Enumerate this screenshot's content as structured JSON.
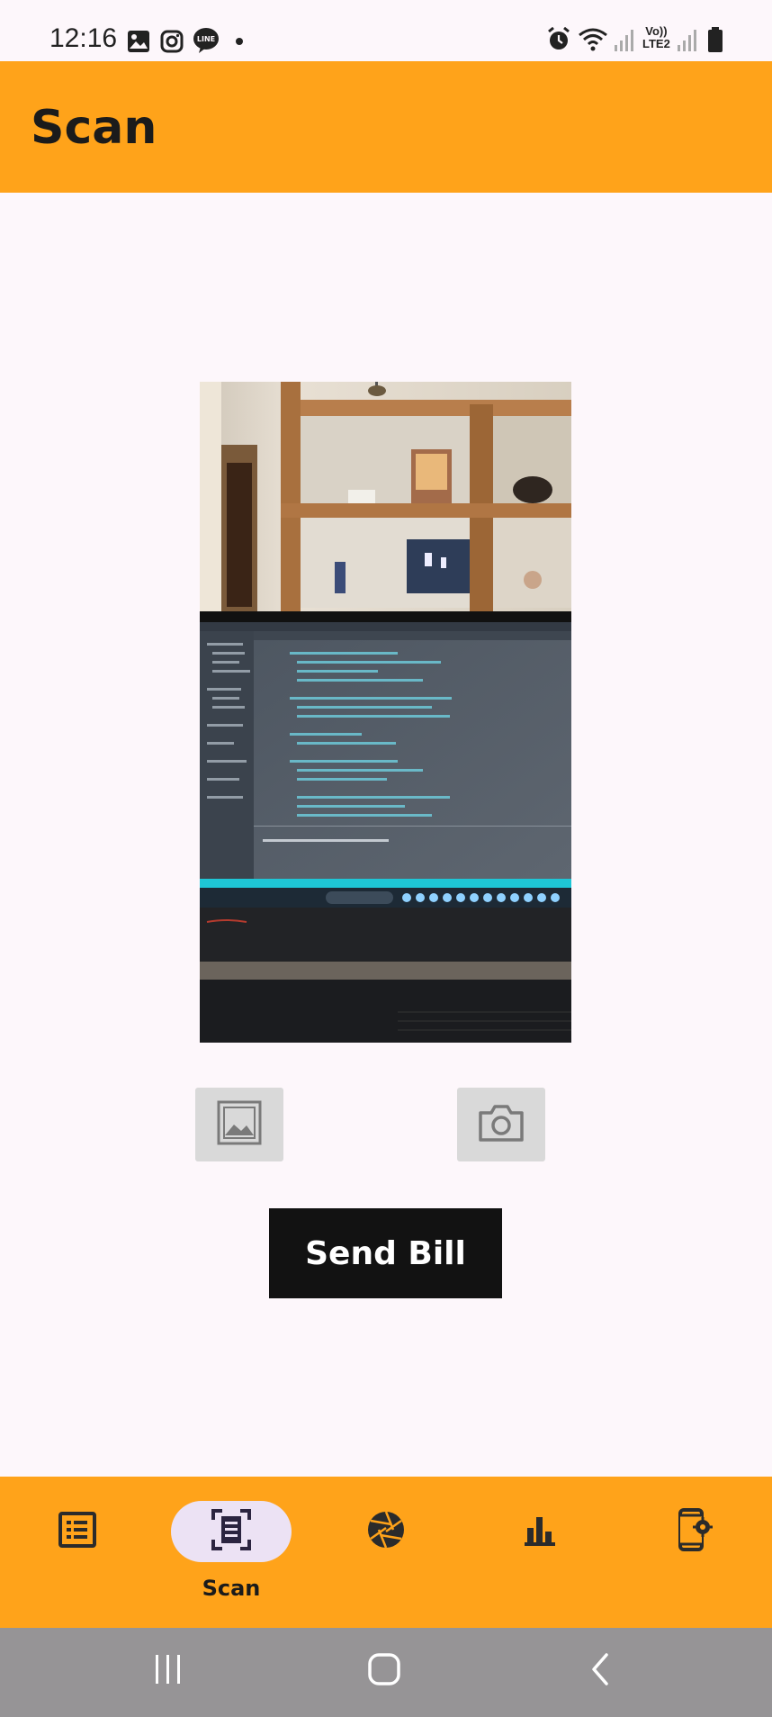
{
  "status_bar": {
    "time": "12:16",
    "left_icons": [
      "image-icon",
      "instagram-icon",
      "line-icon",
      "dot-icon"
    ],
    "right_icons": [
      "alarm-icon",
      "wifi-icon",
      "signal-icon",
      "volte-icon",
      "signal-icon",
      "battery-icon"
    ],
    "volte_line1": "Vo))",
    "volte_line2": "LTE2"
  },
  "app_bar": {
    "title": "Scan"
  },
  "preview": {
    "description_icon": "captured-photo"
  },
  "actions": {
    "gallery_icon": "gallery-icon",
    "camera_icon": "camera-icon",
    "send_label": "Send Bill"
  },
  "bottom_nav": {
    "items": [
      {
        "icon": "list-icon",
        "label": "",
        "active": false
      },
      {
        "icon": "scan-document-icon",
        "label": "Scan",
        "active": true
      },
      {
        "icon": "aperture-icon",
        "label": "",
        "active": false
      },
      {
        "icon": "bar-chart-icon",
        "label": "",
        "active": false
      },
      {
        "icon": "phone-settings-icon",
        "label": "",
        "active": false
      }
    ]
  },
  "system_nav": [
    "recents-icon",
    "home-icon",
    "back-icon"
  ],
  "colors": {
    "accent": "#ffa31a",
    "background": "#fdf7fb",
    "active_pill": "#ece2f4",
    "send_button": "#121212"
  }
}
